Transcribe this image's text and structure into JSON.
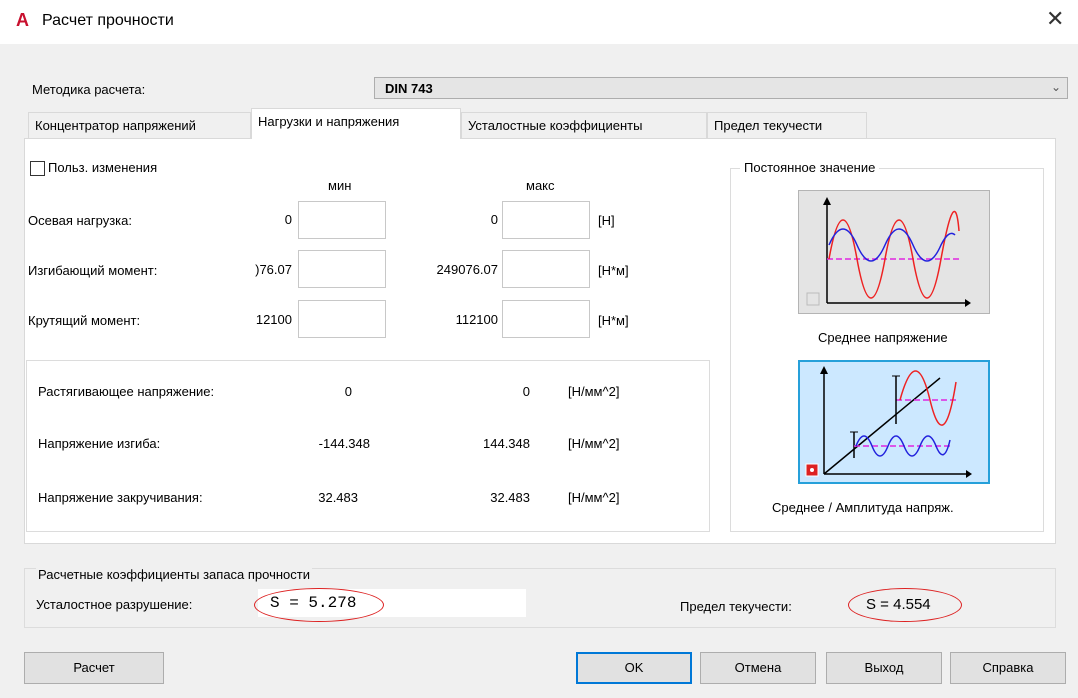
{
  "window": {
    "title": "Расчет прочности",
    "app_icon": "A",
    "close": "✕"
  },
  "method": {
    "label": "Методика расчета:",
    "value": "DIN 743"
  },
  "tabs": [
    {
      "label": "Концентратор напряжений"
    },
    {
      "label": "Нагрузки и напряжения"
    },
    {
      "label": "Усталостные коэффициенты"
    },
    {
      "label": "Предел текучести"
    }
  ],
  "loads": {
    "user_changes_label": "Польз. изменения",
    "min_header": "мин",
    "max_header": "макс",
    "rows": [
      {
        "label": "Осевая нагрузка:",
        "min": "0",
        "max": "0",
        "unit": "[H]"
      },
      {
        "label": "Изгибающий момент:",
        "min": ")76.07",
        "max": "249076.07",
        "unit": "[H*м]"
      },
      {
        "label": "Крутящий момент:",
        "min": "12100",
        "max": "112100",
        "unit": "[H*м]"
      }
    ]
  },
  "stresses": [
    {
      "label": "Растягивающее напряжение:",
      "min": "0",
      "max": "0",
      "unit": "[H/мм^2]"
    },
    {
      "label": "Напряжение изгиба:",
      "min": "-144.348",
      "max": "144.348",
      "unit": "[H/мм^2]"
    },
    {
      "label": "Напряжение закручивания:",
      "min": "32.483",
      "max": "32.483",
      "unit": "[H/мм^2]"
    }
  ],
  "constant": {
    "title": "Постоянное значение",
    "option1": "Среднее напряжение",
    "option2": "Среднее / Амплитуда напряж."
  },
  "safety": {
    "title": "Расчетные коэффициенты запаса прочности",
    "fatigue_label": "Усталостное разрушение:",
    "fatigue_value": "S = 5.278",
    "yield_label": "Предел текучести:",
    "yield_value": "S = 4.554"
  },
  "buttons": {
    "calc": "Расчет",
    "ok": "OK",
    "cancel": "Отмена",
    "exit": "Выход",
    "help": "Справка"
  },
  "colors": {
    "accent": "#0078d7",
    "highlight": "#d22222",
    "app_icon": "#c8102e"
  }
}
